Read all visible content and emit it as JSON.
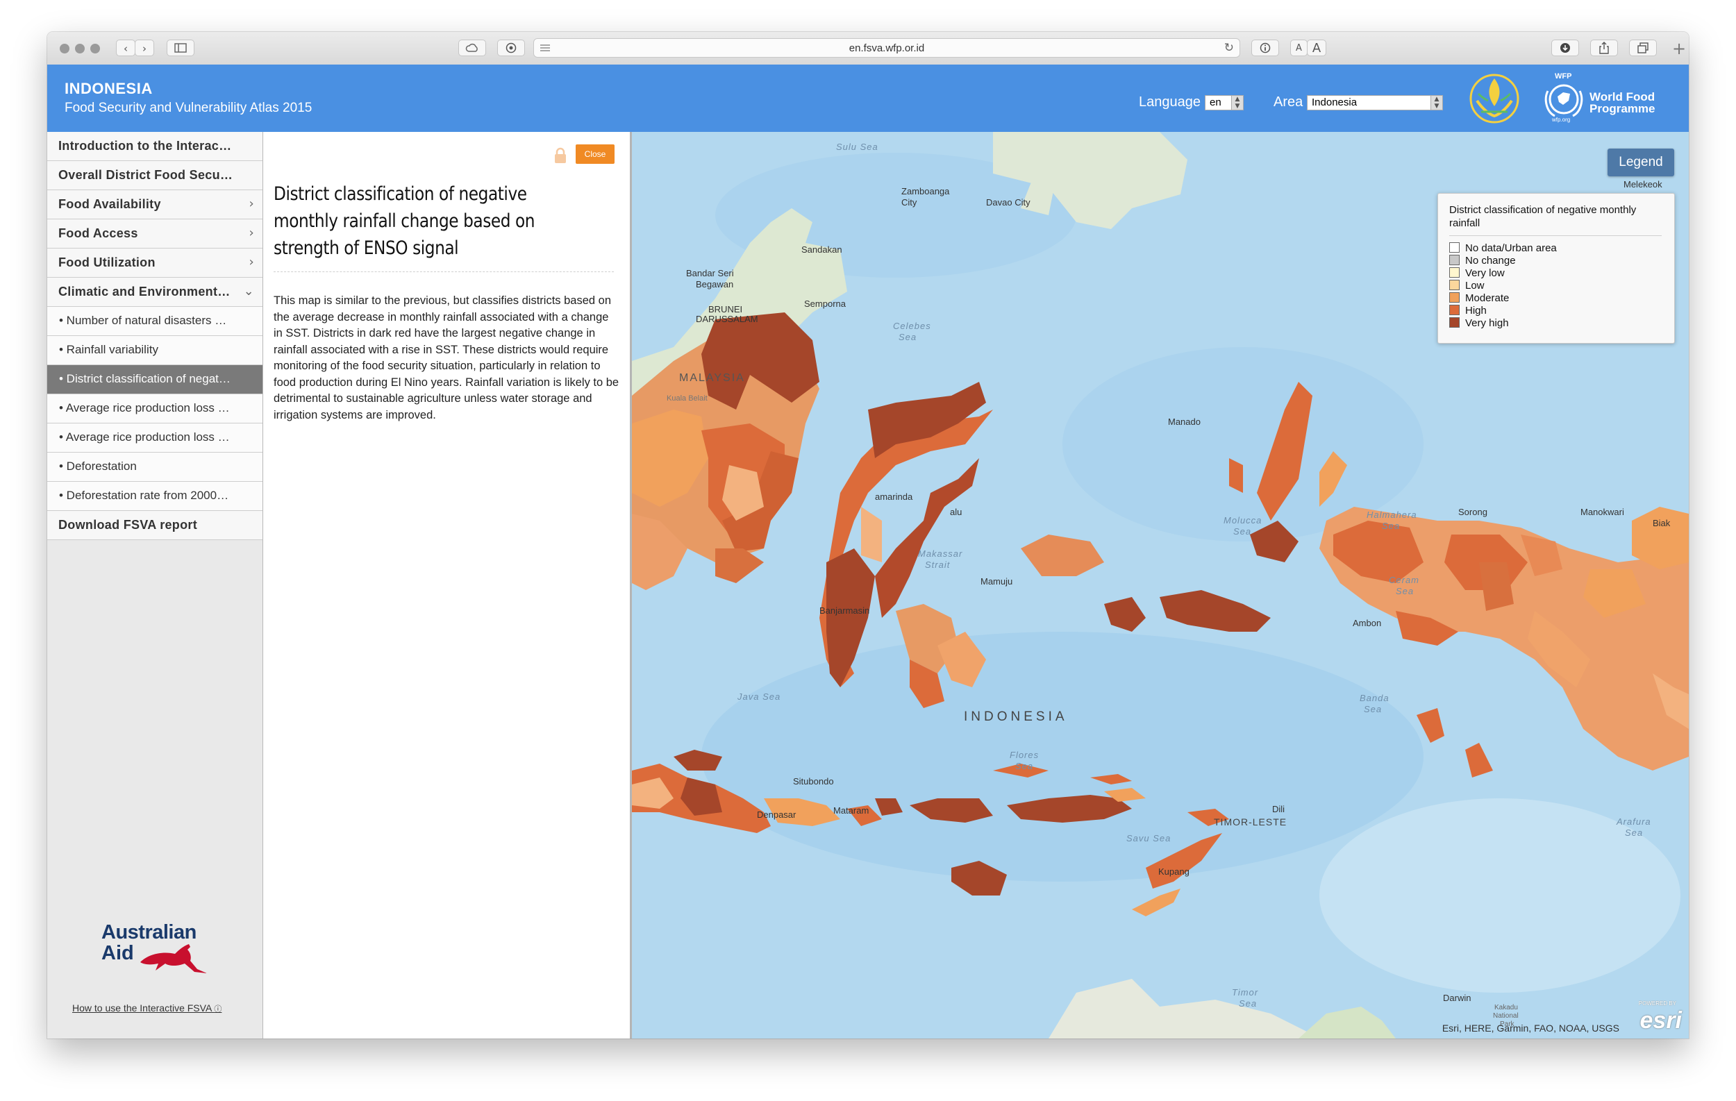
{
  "browser": {
    "url": "en.fsva.wfp.or.id",
    "reader_small": "A",
    "reader_large": "A"
  },
  "header": {
    "title": "INDONESIA",
    "subtitle": "Food Security and Vulnerability Atlas 2015",
    "language_label": "Language",
    "language_value": "en",
    "area_label": "Area",
    "area_value": "Indonesia",
    "wfp_top": "WFP",
    "wfp_line1": "World Food",
    "wfp_line2": "Programme",
    "wfp_url": "wfp.org"
  },
  "sidebar": {
    "items": [
      {
        "label": "Introduction to the Interac…"
      },
      {
        "label": "Overall District Food Secu…"
      },
      {
        "label": "Food Availability"
      },
      {
        "label": "Food Access"
      },
      {
        "label": "Food Utilization"
      },
      {
        "label": "Climatic and Environment…"
      },
      {
        "label": "• Number of natural disasters …"
      },
      {
        "label": "• Rainfall variability"
      },
      {
        "label": "• District classification of negat…"
      },
      {
        "label": "• Average rice production loss …"
      },
      {
        "label": "• Average rice production loss …"
      },
      {
        "label": "• Deforestation"
      },
      {
        "label": "• Deforestation rate from 2000…"
      },
      {
        "label": "Download FSVA report"
      }
    ],
    "aid_line1": "Australian",
    "aid_line2": "Aid",
    "help_link": "How to use the Interactive FSVA"
  },
  "panel": {
    "close_label": "Close",
    "title": "District classification of negative monthly rainfall change based on strength of ENSO signal",
    "body": "This map is similar to the previous, but classifies districts based on the average decrease in monthly rainfall associated with a change in SST. Districts in dark red have the largest negative change in rainfall associated with a rise in SST.  These districts would require monitoring of the food security situation, particularly in relation to food production during El Nino years.  Rainfall variation is likely to be detrimental to sustainable agriculture unless water storage and irrigation systems are improved."
  },
  "map": {
    "legend_button": "Legend",
    "legend_title": "District classification of negative monthly rainfall",
    "legend_items": [
      {
        "label": "No data/Urban area",
        "color": "#ffffff"
      },
      {
        "label": "No change",
        "color": "#c8c8c8"
      },
      {
        "label": "Very low",
        "color": "#fff7cf"
      },
      {
        "label": "Low",
        "color": "#fcd79c"
      },
      {
        "label": "Moderate",
        "color": "#f1a15c"
      },
      {
        "label": "High",
        "color": "#dc6b3a"
      },
      {
        "label": "Very high",
        "color": "#a5462a"
      }
    ],
    "labels": {
      "sulu_sea": "Sulu Sea",
      "zamboanga": "Zamboanga",
      "zamboanga2": "City",
      "davao": "Davao City",
      "melekeok": "Melekeok",
      "sandakan": "Sandakan",
      "bandar1": "Bandar Seri",
      "bandar2": "Begawan",
      "brunei1": "BRUNEI",
      "brunei2": "DARUSSALAM",
      "semporna": "Semporna",
      "celebes1": "Celebes",
      "celebes2": "Sea",
      "malaysia": "MALAYSIA",
      "kuala": "Kuala Belait",
      "manado": "Manado",
      "samarinda": "amarinda",
      "palu": "alu",
      "molucca1": "Molucca",
      "molucca2": "Sea",
      "halmahera1": "Halmahera",
      "halmahera2": "Sea",
      "sorong": "Sorong",
      "manokwari": "Manokwari",
      "biak": "Biak",
      "makassar1": "Makassar",
      "makassar2": "Strait",
      "mamuju": "Mamuju",
      "ceram1": "Ceram",
      "ceram2": "Sea",
      "ambon": "Ambon",
      "banjarmasin": "Banjarmasin",
      "java_sea": "Java Sea",
      "indonesia": "INDONESIA",
      "banda1": "Banda",
      "banda2": "Sea",
      "flores1": "Flores",
      "flores2": "Sea",
      "situbondo": "Situbondo",
      "denpasar": "Denpasar",
      "mataram": "Mataram",
      "dili": "Dili",
      "timor_leste": "TIMOR-LESTE",
      "savu": "Savu Sea",
      "kupang": "Kupang",
      "arafura1": "Arafura",
      "arafura2": "Sea",
      "timor1": "Timor",
      "timor2": "Sea",
      "darwin": "Darwin",
      "kakadu1": "Kakadu",
      "kakadu2": "National",
      "kakadu3": "Park"
    },
    "attribution": "Esri, HERE, Garmin, FAO, NOAA, USGS",
    "esri_powered": "POWERED BY",
    "esri_logo": "esri"
  }
}
